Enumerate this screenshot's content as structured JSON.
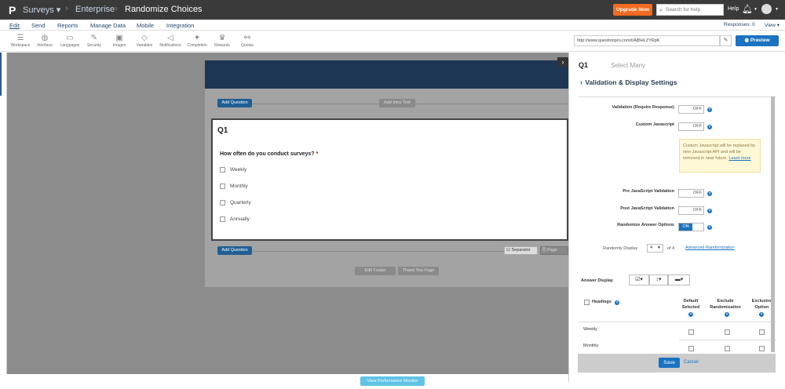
{
  "topbar": {
    "logo": "P",
    "crumbs": [
      "Surveys ▾",
      "Enterprise",
      "Randomize Choices"
    ],
    "upgrade": "Upgrade Now",
    "search_placeholder": "Search for help",
    "help": "Help",
    "bg_color": "#3a3a3a",
    "accent": "#f26b21"
  },
  "menu": {
    "items": [
      "Edit",
      "Send",
      "Reports",
      "Manage Data",
      "Mobile",
      "Integration"
    ],
    "responses": "Responses: 0",
    "view": "View ▾"
  },
  "toolbar": {
    "tools": [
      {
        "label": "Workspace",
        "icon": "workspace-icon",
        "glyph": "☰"
      },
      {
        "label": "Interface",
        "icon": "palette-icon",
        "glyph": "◍"
      },
      {
        "label": "Languages",
        "icon": "languages-icon",
        "glyph": "▭"
      },
      {
        "label": "Security",
        "icon": "wrench-icon",
        "glyph": "✎"
      },
      {
        "label": "Images",
        "icon": "image-icon",
        "glyph": "▣"
      },
      {
        "label": "Variables",
        "icon": "tag-icon",
        "glyph": "◇"
      },
      {
        "label": "Notifications",
        "icon": "megaphone-icon",
        "glyph": "◁"
      },
      {
        "label": "Completion",
        "icon": "wand-icon",
        "glyph": "✦"
      },
      {
        "label": "Rewards",
        "icon": "trophy-icon",
        "glyph": "♛"
      },
      {
        "label": "Quotas",
        "icon": "quotas-icon",
        "glyph": "⚯"
      }
    ],
    "url": "http://www.questionpro.com/t/AlBHLZYRpK",
    "preview": "Preview"
  },
  "canvas": {
    "add_question": "Add Question",
    "add_intro_text": "Add Intro Text",
    "question_number": "Q1",
    "question_text": "How often do you conduct surveys?",
    "required_mark": "*",
    "options": [
      "Weekly",
      "Monthly",
      "Quarterly",
      "Annually"
    ],
    "add_question_bottom": "Add Question",
    "separator": "Separator",
    "page_break": "Page Break",
    "edit_footer": "Edit Footer",
    "thank_you_page": "Thank You Page",
    "perf_monitor": "View Performance Monitor"
  },
  "panel": {
    "question_id": "Q1",
    "question_type": "Select Many",
    "heading": "Validation & Display Settings",
    "validation_label": "Validation (Require Response)",
    "validation_state": "OFF",
    "custom_js_label": "Custom Javascript",
    "custom_js_state": "OFF",
    "note_text": "Custom Javascript will be replaced by new Javascript API and will be removed in near future.",
    "note_link": "Learn more",
    "pre_js_label": "Pre JavaScript Validation",
    "pre_js_state": "OFF",
    "post_js_label": "Post JavaScript Validation",
    "post_js_state": "OFF",
    "randomize_label": "Randomize Answer Options",
    "randomize_state": "ON",
    "randomly_display_label": "Randomly Display",
    "randomly_display_value": "4",
    "of_total": "of   4",
    "advanced_randomization": "Advanced Randomization",
    "answer_display_label": "Answer Display",
    "table_headers": {
      "headings": "Headings",
      "default_selected": [
        "Default",
        "Selected"
      ],
      "exclude_randomization": [
        "Exclude",
        "Randomization"
      ],
      "exclusive_option": [
        "Exclusive",
        "Option"
      ]
    },
    "rows": [
      "Weekly",
      "Monthly"
    ],
    "save": "Save",
    "cancel": "Cancel"
  }
}
